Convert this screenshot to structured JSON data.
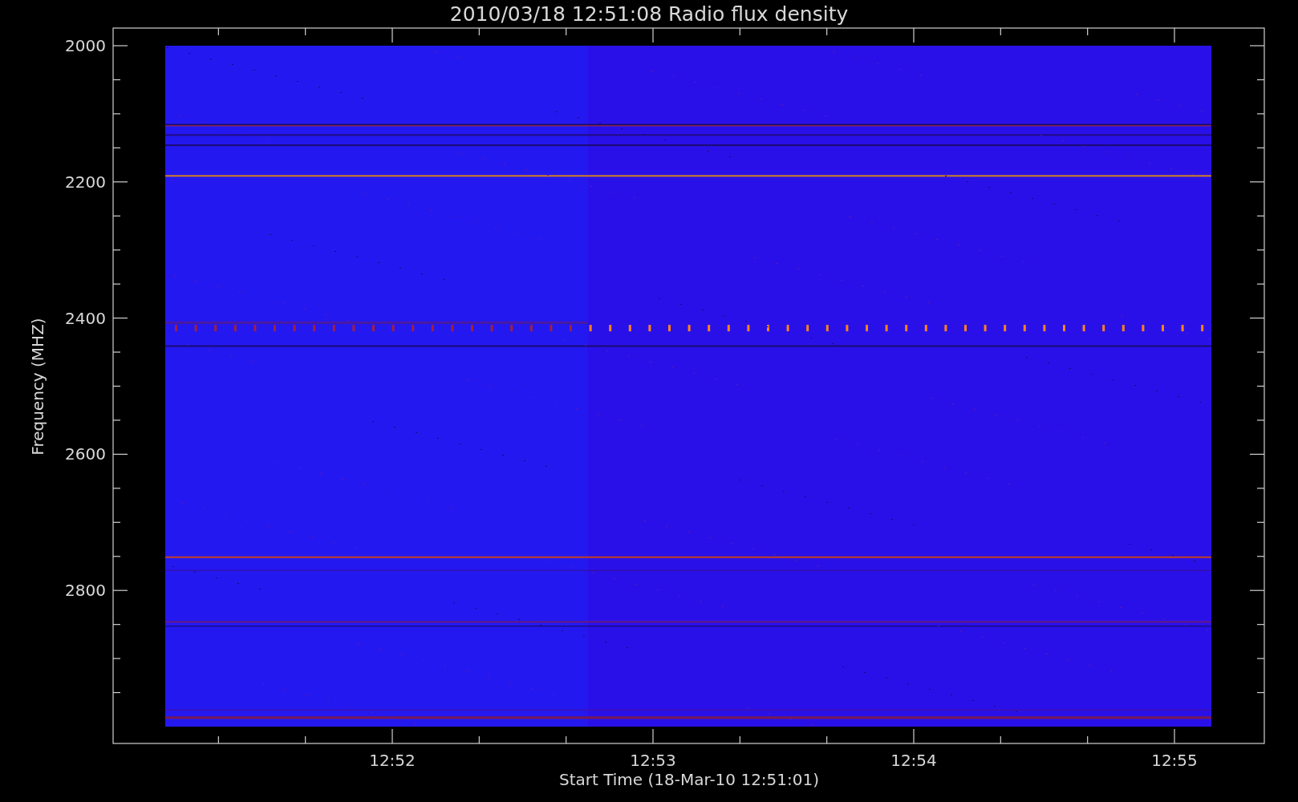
{
  "title": "2010/03/18 12:51:08 Radio flux density",
  "y_axis": {
    "label": "Frequency (MHZ)",
    "ticks": [
      "2000",
      "2200",
      "2400",
      "2600",
      "2800"
    ]
  },
  "x_axis": {
    "label": "Start Time (18-Mar-10 12:51:01)",
    "ticks": [
      "12:52",
      "12:53",
      "12:54",
      "12:55"
    ]
  }
}
